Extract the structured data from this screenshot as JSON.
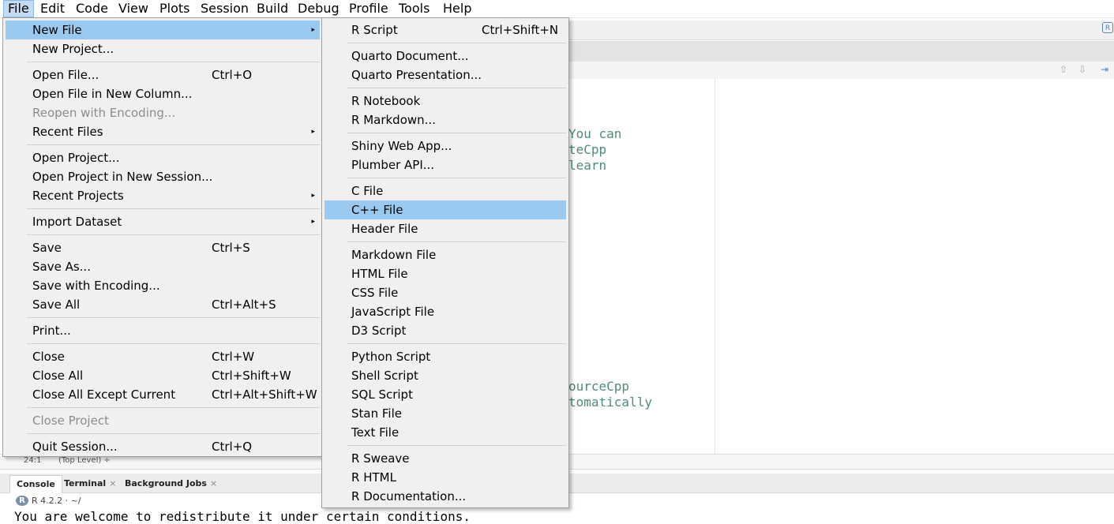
{
  "menubar": {
    "items": [
      {
        "name": "file",
        "label": "File"
      },
      {
        "name": "edit",
        "label": "Edit"
      },
      {
        "name": "code",
        "label": "Code"
      },
      {
        "name": "view",
        "label": "View"
      },
      {
        "name": "plots",
        "label": "Plots"
      },
      {
        "name": "session",
        "label": "Session"
      },
      {
        "name": "build",
        "label": "Build"
      },
      {
        "name": "debug",
        "label": "Debug"
      },
      {
        "name": "profile",
        "label": "Profile"
      },
      {
        "name": "tools",
        "label": "Tools"
      },
      {
        "name": "help",
        "label": "Help"
      }
    ]
  },
  "file_menu": {
    "items": [
      {
        "label": "New File",
        "shortcut": "",
        "submenu": true,
        "highlighted": true
      },
      {
        "label": "New Project...",
        "shortcut": ""
      },
      {
        "label": "Open File...",
        "shortcut": "Ctrl+O"
      },
      {
        "label": "Open File in New Column...",
        "shortcut": ""
      },
      {
        "label": "Reopen with Encoding...",
        "shortcut": "",
        "disabled": true
      },
      {
        "label": "Recent Files",
        "shortcut": "",
        "submenu": true
      },
      {
        "label": "Open Project...",
        "shortcut": ""
      },
      {
        "label": "Open Project in New Session...",
        "shortcut": ""
      },
      {
        "label": "Recent Projects",
        "shortcut": "",
        "submenu": true
      },
      {
        "label": "Import Dataset",
        "shortcut": "",
        "submenu": true
      },
      {
        "label": "Save",
        "shortcut": "Ctrl+S"
      },
      {
        "label": "Save As...",
        "shortcut": ""
      },
      {
        "label": "Save with Encoding...",
        "shortcut": ""
      },
      {
        "label": "Save All",
        "shortcut": "Ctrl+Alt+S"
      },
      {
        "label": "Print...",
        "shortcut": ""
      },
      {
        "label": "Close",
        "shortcut": "Ctrl+W"
      },
      {
        "label": "Close All",
        "shortcut": "Ctrl+Shift+W"
      },
      {
        "label": "Close All Except Current",
        "shortcut": "Ctrl+Alt+Shift+W"
      },
      {
        "label": "Close Project",
        "shortcut": "",
        "disabled": true
      },
      {
        "label": "Quit Session...",
        "shortcut": "Ctrl+Q"
      }
    ]
  },
  "new_file_menu": {
    "items": [
      {
        "label": "R Script",
        "shortcut": "Ctrl+Shift+N"
      },
      {
        "label": "Quarto Document...",
        "shortcut": ""
      },
      {
        "label": "Quarto Presentation...",
        "shortcut": ""
      },
      {
        "label": "R Notebook",
        "shortcut": ""
      },
      {
        "label": "R Markdown...",
        "shortcut": ""
      },
      {
        "label": "Shiny Web App...",
        "shortcut": ""
      },
      {
        "label": "Plumber API...",
        "shortcut": ""
      },
      {
        "label": "C File",
        "shortcut": ""
      },
      {
        "label": "C++ File",
        "shortcut": "",
        "highlighted": true
      },
      {
        "label": "Header File",
        "shortcut": ""
      },
      {
        "label": "Markdown File",
        "shortcut": ""
      },
      {
        "label": "HTML File",
        "shortcut": ""
      },
      {
        "label": "CSS File",
        "shortcut": ""
      },
      {
        "label": "JavaScript File",
        "shortcut": ""
      },
      {
        "label": "D3 Script",
        "shortcut": ""
      },
      {
        "label": "Python Script",
        "shortcut": ""
      },
      {
        "label": "Shell Script",
        "shortcut": ""
      },
      {
        "label": "SQL Script",
        "shortcut": ""
      },
      {
        "label": "Stan File",
        "shortcut": ""
      },
      {
        "label": "Text File",
        "shortcut": ""
      },
      {
        "label": "R Sweave",
        "shortcut": ""
      },
      {
        "label": "R HTML",
        "shortcut": ""
      },
      {
        "label": "R Documentation...",
        "shortcut": ""
      }
    ]
  },
  "editor": {
    "visible_code": [
      "You can",
      "teCpp",
      "learn",
      "ourceCpp",
      "tomatically"
    ]
  },
  "status": {
    "position": "24:1",
    "scope": "(Top Level) ÷"
  },
  "console": {
    "tabs": [
      {
        "label": "Console",
        "active": true
      },
      {
        "label": "Terminal",
        "close": "×"
      },
      {
        "label": "Background Jobs",
        "close": "×"
      }
    ],
    "r_version": "R 4.2.2 · ~/",
    "output_line": "You are welcome to redistribute it under certain conditions."
  },
  "icons": {
    "submenu_arrow": "▸",
    "r_logo": "R"
  },
  "colors": {
    "menu_bg": "#f0f0f0",
    "highlight": "#99c9ef",
    "code_green": "#4d8c78"
  }
}
